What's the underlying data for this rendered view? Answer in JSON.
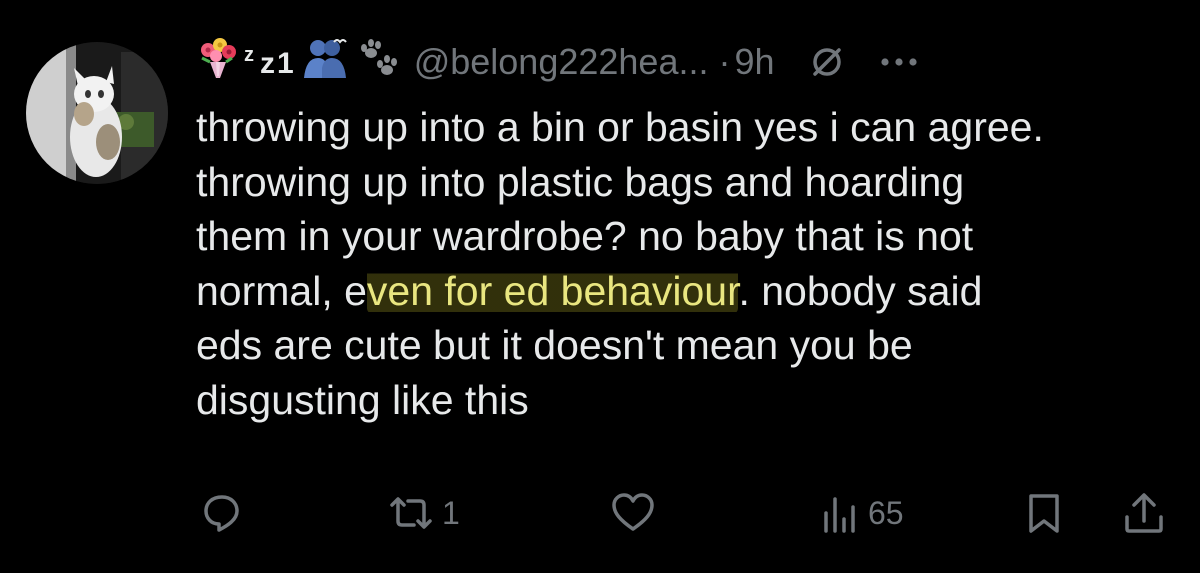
{
  "author": {
    "handle": "@belong222hea...",
    "separator": "·",
    "time": "9h",
    "name_text_small": "z",
    "name_text": "z1",
    "emoji_icons": [
      "bouquet-icon",
      "two-people-hugging-icon",
      "paw-prints-icon"
    ]
  },
  "tweet": {
    "text_before": "throwing up into a bin or basin yes i can agree.\nthrowing up into plastic bags and hoarding\nthem in your wardrobe? no baby that is not\nnormal, e",
    "text_highlight": "ven for ed behaviour",
    "text_after": ". nobody said\neds are cute but it doesn't mean you be\ndisgusting like this"
  },
  "actions": {
    "reply_count": "",
    "repost_count": "1",
    "like_count": "",
    "views_count": "65"
  },
  "colors": {
    "background": "#000000",
    "text": "#e7e9ea",
    "muted": "#71767b",
    "highlight_text": "#e9e680"
  }
}
